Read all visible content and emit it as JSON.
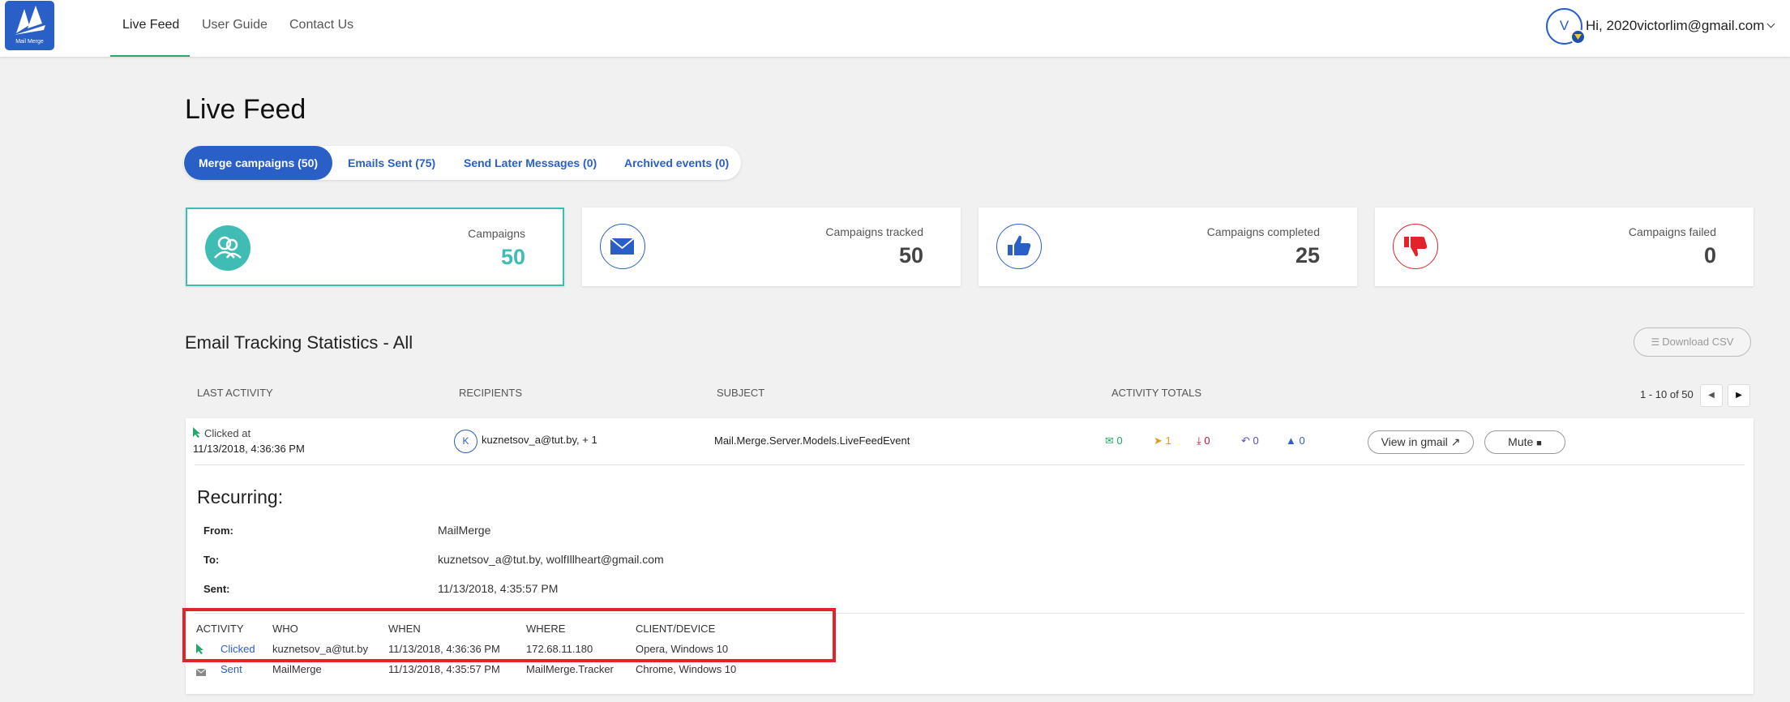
{
  "navbar": {
    "logo_text": "Mail Merge",
    "items": [
      {
        "label": "Live Feed",
        "active": true
      },
      {
        "label": "User Guide",
        "active": false
      },
      {
        "label": "Contact Us",
        "active": false
      }
    ],
    "avatar_letter": "V",
    "greeting": "Hi, 2020victorlim@gmail.com"
  },
  "page_title": "Live Feed",
  "tabs": [
    {
      "label": "Merge campaigns (50)",
      "active": true
    },
    {
      "label": "Emails Sent (75)",
      "active": false
    },
    {
      "label": "Send Later Messages (0)",
      "active": false
    },
    {
      "label": "Archived events (0)",
      "active": false
    }
  ],
  "stat_cards": [
    {
      "label": "Campaigns",
      "value": "50",
      "icon": "users-icon",
      "color": "#3fbcb4"
    },
    {
      "label": "Campaigns tracked",
      "value": "50",
      "icon": "envelope-icon",
      "color": "#2a5fc7"
    },
    {
      "label": "Campaigns completed",
      "value": "25",
      "icon": "thumbs-up-icon",
      "color": "#2a5fc7"
    },
    {
      "label": "Campaigns failed",
      "value": "0",
      "icon": "thumbs-down-icon",
      "color": "#e0242a"
    }
  ],
  "stats": {
    "title": "Email Tracking Statistics - All",
    "download_label": "Download CSV",
    "columns": [
      "LAST ACTIVITY",
      "RECIPIENTS",
      "SUBJECT",
      "ACTIVITY TOTALS"
    ],
    "pagination": "1 - 10 of 50"
  },
  "row": {
    "last_activity_label": "Clicked at",
    "last_activity_time": "11/13/2018, 4:36:36 PM",
    "recipient_initial": "K",
    "recipients": "kuznetsov_a@tut.by, + 1",
    "subject": "Mail.Merge.Server.Models.LiveFeedEvent",
    "totals": [
      {
        "icon": "envelope-open-icon",
        "value": "0",
        "color": "#27a86a"
      },
      {
        "icon": "cursor-icon",
        "value": "1",
        "color": "#e39a1a"
      },
      {
        "icon": "download-icon",
        "value": "0",
        "color": "#c4143c"
      },
      {
        "icon": "reply-icon",
        "value": "0",
        "color": "#5a4fb5"
      },
      {
        "icon": "thumbs-up-icon",
        "value": "0",
        "color": "#2a5fc7"
      }
    ],
    "view_label": "View in gmail",
    "mute_label": "Mute"
  },
  "detail": {
    "title": "Recurring:",
    "from_label": "From:",
    "from_value": "MailMerge",
    "to_label": "To:",
    "to_value": "kuznetsov_a@tut.by, wolfIllheart@gmail.com",
    "sent_label": "Sent:",
    "sent_value": "11/13/2018, 4:35:57 PM",
    "event_columns": [
      "ACTIVITY",
      "WHO",
      "WHEN",
      "WHERE",
      "CLIENT/DEVICE"
    ],
    "events": [
      {
        "activity": "Clicked",
        "who": "kuznetsov_a@tut.by",
        "when": "11/13/2018, 4:36:36 PM",
        "where": "172.68.11.180",
        "client": "Opera, Windows 10"
      },
      {
        "activity": "Sent",
        "who": "MailMerge",
        "when": "11/13/2018, 4:35:57 PM",
        "where": "MailMerge.Tracker",
        "client": "Chrome, Windows 10"
      }
    ]
  }
}
